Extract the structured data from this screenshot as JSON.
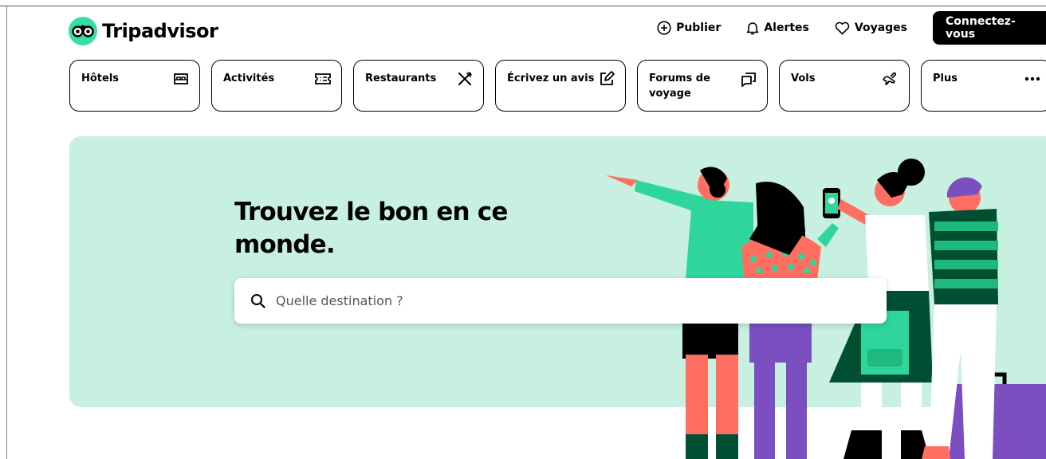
{
  "brand": {
    "name": "Tripadvisor"
  },
  "header": {
    "publish_label": "Publier",
    "alerts_label": "Alertes",
    "trips_label": "Voyages",
    "login_label": "Connectez-vous"
  },
  "categories": [
    {
      "label": "Hôtels",
      "icon": "bed-icon"
    },
    {
      "label": "Activités",
      "icon": "ticket-icon"
    },
    {
      "label": "Restaurants",
      "icon": "utensils-icon"
    },
    {
      "label": "Écrivez un avis",
      "icon": "edit-icon"
    },
    {
      "label": "Forums de voyage",
      "icon": "chat-icon"
    },
    {
      "label": "Vols",
      "icon": "plane-icon"
    },
    {
      "label": "Plus",
      "icon": "more-icon"
    }
  ],
  "hero": {
    "title": "Trouvez le bon en ce monde.",
    "search_placeholder": "Quelle destination ?"
  },
  "colors": {
    "brand_green": "#34e0a1",
    "hero_bg": "#c8f0e1",
    "illustration_coral": "#ff6f61",
    "illustration_purple": "#7b4fbf",
    "illustration_dark_green": "#004f32"
  }
}
